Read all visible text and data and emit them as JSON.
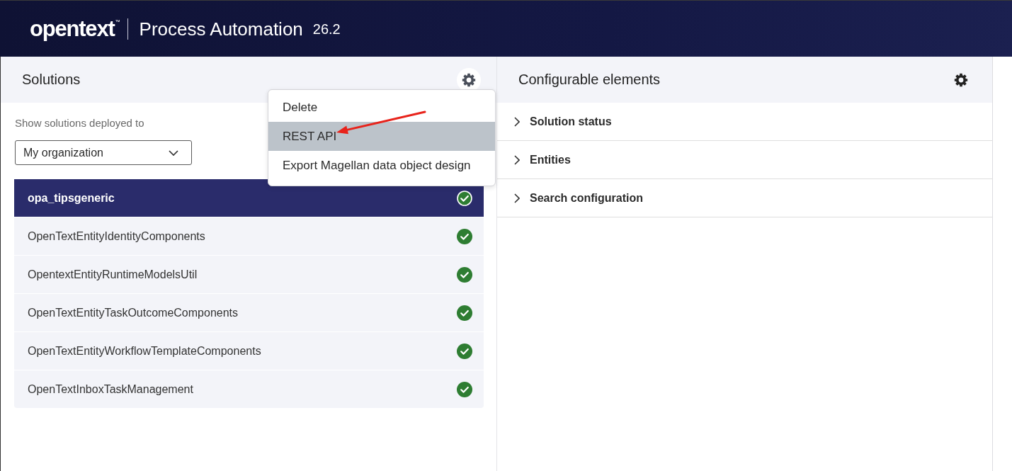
{
  "header": {
    "logo": "opentext$^{™}$",
    "product": "Process Automation",
    "version": "26.2"
  },
  "solutions_panel": {
    "title": "Solutions",
    "filter_label": "Show solutions deployed to",
    "filter": {
      "value": "My organization"
    },
    "items": [
      {
        "name": "opa_tipsgeneric",
        "selected": true
      },
      {
        "name": "OpenTextEntityIdentityComponents",
        "selected": false
      },
      {
        "name": "OpentextEntityRuntimeModelsUtil",
        "selected": false
      },
      {
        "name": "OpenTextEntityTaskOutcomeComponents",
        "selected": false
      },
      {
        "name": "OpenTextEntityWorkflowTemplateComponents",
        "selected": false
      },
      {
        "name": "OpenTextInboxTaskManagement",
        "selected": false
      }
    ]
  },
  "settings_menu": {
    "items": [
      {
        "label": "Delete",
        "highlighted": false
      },
      {
        "label": "REST API",
        "highlighted": true
      },
      {
        "label": "Export Magellan data object design",
        "highlighted": false
      }
    ]
  },
  "elements_panel": {
    "title": "Configurable elements",
    "sections": [
      {
        "label": "Solution status",
        "expanded": false
      },
      {
        "label": "Entities",
        "expanded": false
      },
      {
        "label": "Search configuration",
        "expanded": false
      }
    ]
  }
}
